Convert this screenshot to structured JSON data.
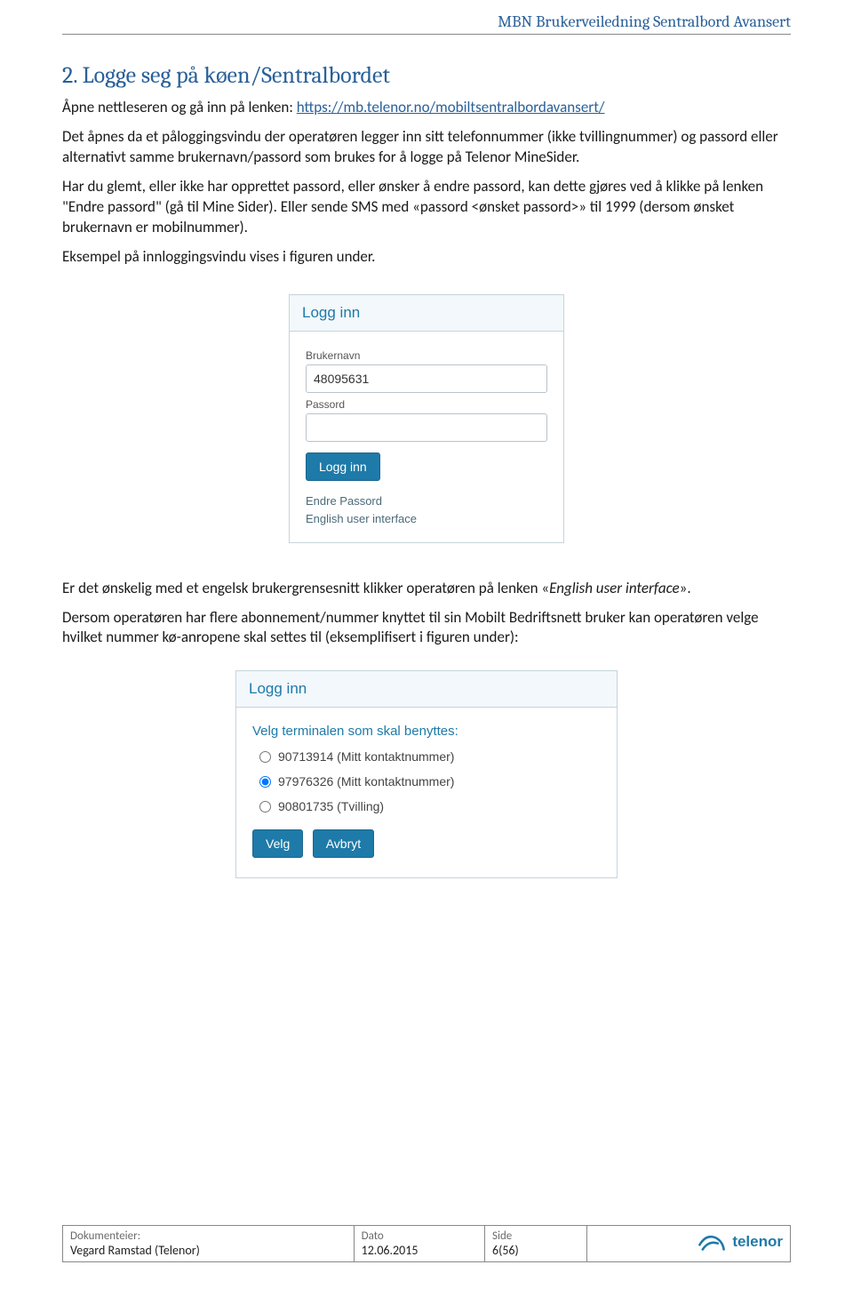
{
  "header": {
    "title": "MBN Brukerveiledning Sentralbord Avansert"
  },
  "section": {
    "heading": "2. Logge seg på køen/Sentralbordet",
    "p1_pre": "Åpne nettleseren og gå inn på lenken: ",
    "p1_link": "https://mb.telenor.no/mobiltsentralbordavansert/",
    "p2": "Det åpnes da et påloggingsvindu der operatøren legger inn sitt telefonnummer (ikke tvillingnummer) og passord eller alternativt samme brukernavn/passord som brukes for å logge på Telenor MineSider.",
    "p3": "Har du glemt, eller ikke har opprettet passord, eller ønsker å endre passord, kan dette gjøres ved å klikke på lenken \"Endre passord\" (gå til Mine Sider). Eller sende SMS med «passord <ønsket passord>» til 1999 (dersom ønsket brukernavn er mobilnummer).",
    "p4": "Eksempel på innloggingsvindu vises i figuren under.",
    "p5_pre": "Er det ønskelig med et engelsk brukergrensesnitt klikker operatøren på lenken «",
    "p5_em": "English user interface",
    "p5_post": "».",
    "p6": "Dersom operatøren har flere abonnement/nummer knyttet til sin Mobilt Bedriftsnett bruker kan operatøren velge hvilket nummer kø-anropene skal settes til (eksemplifisert i figuren under):"
  },
  "login": {
    "title": "Logg inn",
    "username_label": "Brukernavn",
    "username_value": "48095631",
    "password_label": "Passord",
    "button": "Logg inn",
    "link_change": "Endre Passord",
    "link_english": "English user interface"
  },
  "terminal": {
    "title": "Logg inn",
    "prompt": "Velg terminalen som skal benyttes:",
    "options": [
      {
        "label": "90713914 (Mitt kontaktnummer)",
        "selected": false
      },
      {
        "label": "97976326 (Mitt kontaktnummer)",
        "selected": true
      },
      {
        "label": "90801735 (Tvilling)",
        "selected": false
      }
    ],
    "btn_select": "Velg",
    "btn_cancel": "Avbryt"
  },
  "footer": {
    "owner_label": "Dokumenteier:",
    "owner_value": "Vegard Ramstad (Telenor)",
    "date_label": "Dato",
    "date_value": "12.06.2015",
    "page_label": "Side",
    "page_value": "6(56)",
    "logo_text": "telenor"
  }
}
